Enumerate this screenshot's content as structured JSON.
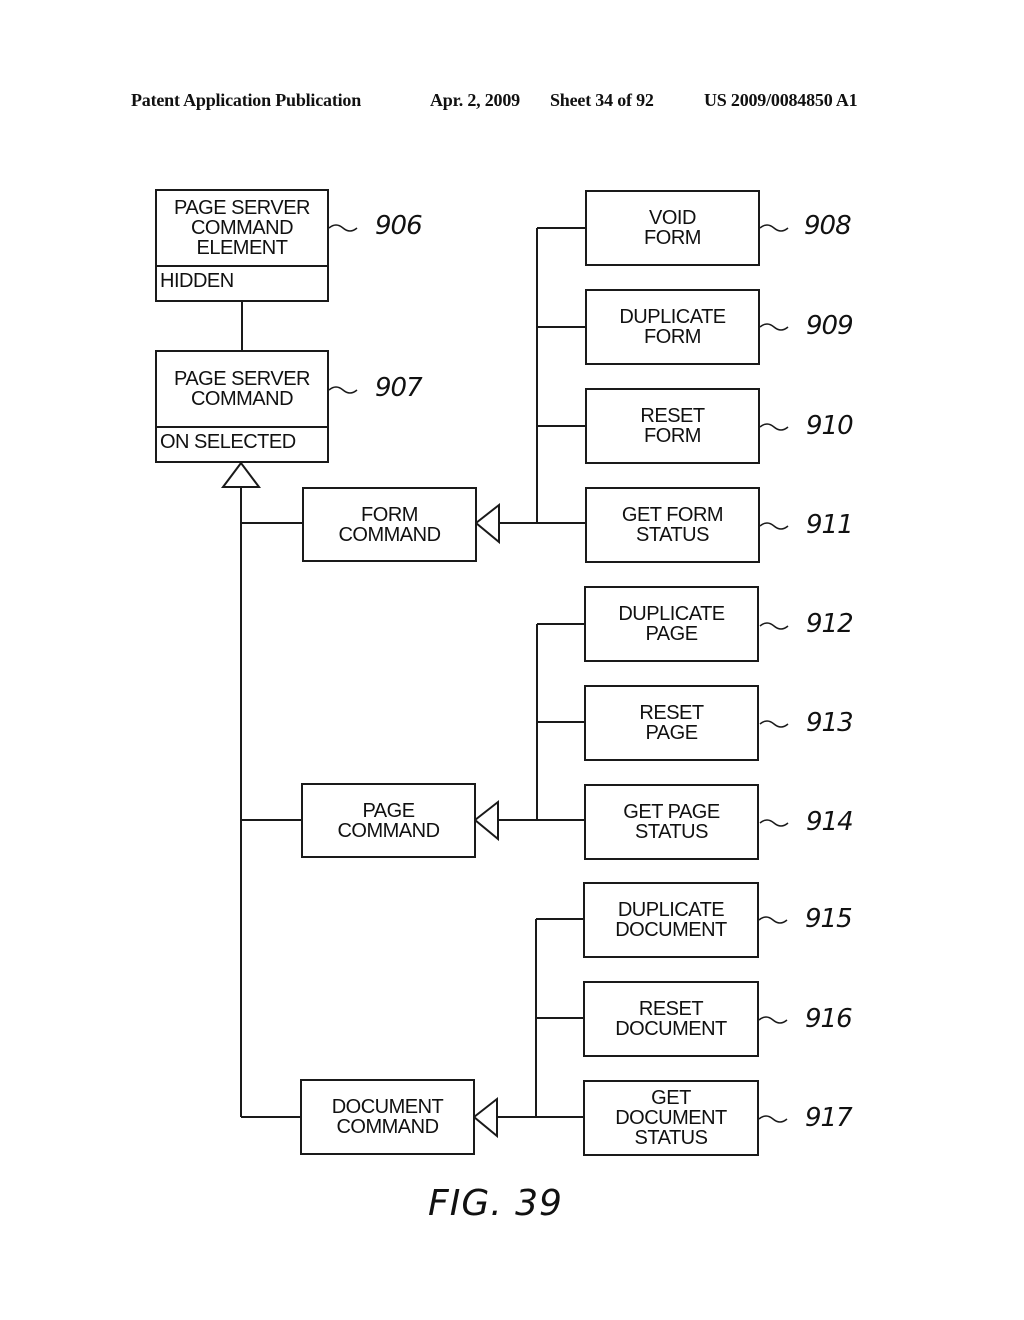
{
  "header": {
    "publication": "Patent Application Publication",
    "date": "Apr. 2, 2009",
    "sheet": "Sheet 34 of 92",
    "number": "US 2009/0084850 A1"
  },
  "figure_label": "FIG. 39",
  "classes": {
    "page_server_command_element": {
      "name": "PAGE SERVER\nCOMMAND\nELEMENT",
      "attribute": "HIDDEN",
      "ref": "906"
    },
    "page_server_command": {
      "name": "PAGE SERVER\nCOMMAND",
      "attribute": "ON SELECTED",
      "ref": "907"
    }
  },
  "subclasses": {
    "form_command": "FORM\nCOMMAND",
    "page_command": "PAGE\nCOMMAND",
    "document_command": "DOCUMENT\nCOMMAND"
  },
  "leaves": [
    {
      "label": "VOID\nFORM",
      "ref": "908"
    },
    {
      "label": "DUPLICATE\nFORM",
      "ref": "909"
    },
    {
      "label": "RESET\nFORM",
      "ref": "910"
    },
    {
      "label": "GET FORM\nSTATUS",
      "ref": "911"
    },
    {
      "label": "DUPLICATE\nPAGE",
      "ref": "912"
    },
    {
      "label": "RESET\nPAGE",
      "ref": "913"
    },
    {
      "label": "GET PAGE\nSTATUS",
      "ref": "914"
    },
    {
      "label": "DUPLICATE\nDOCUMENT",
      "ref": "915"
    },
    {
      "label": "RESET\nDOCUMENT",
      "ref": "916"
    },
    {
      "label": "GET\nDOCUMENT\nSTATUS",
      "ref": "917"
    }
  ]
}
